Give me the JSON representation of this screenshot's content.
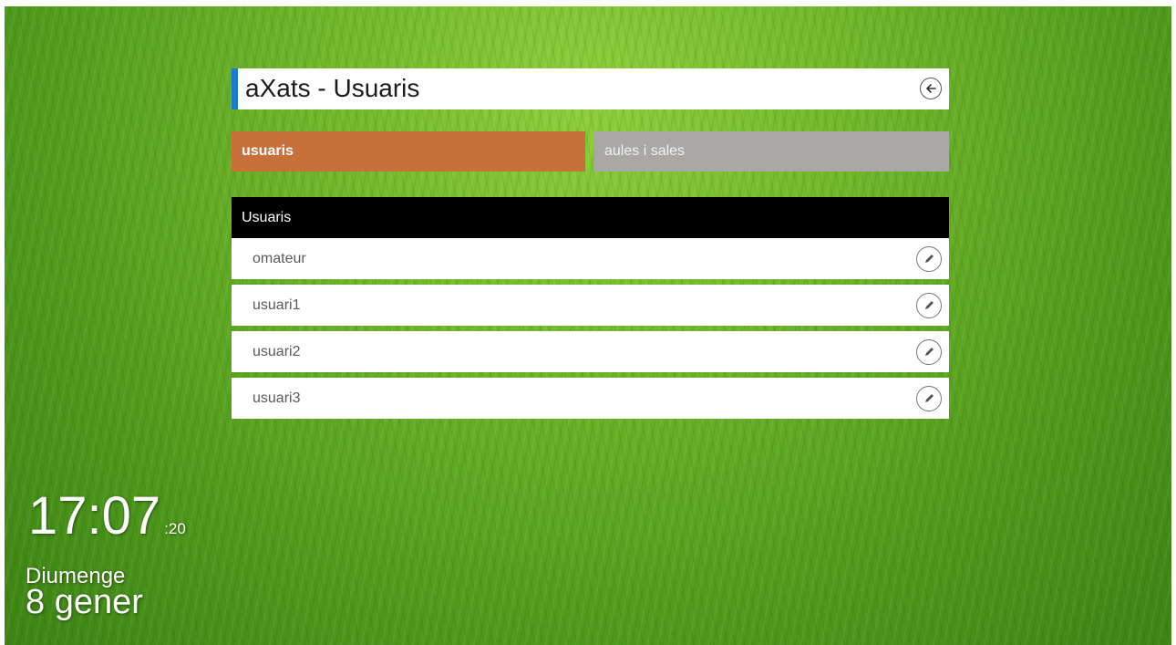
{
  "app": {
    "title": "aXats - Usuaris"
  },
  "tabs": [
    {
      "label": "usuaris",
      "active": true
    },
    {
      "label": "aules i sales",
      "active": false
    }
  ],
  "list": {
    "header": "Usuaris",
    "rows": [
      {
        "name": "omateur"
      },
      {
        "name": "usuari1"
      },
      {
        "name": "usuari2"
      },
      {
        "name": "usuari3"
      }
    ],
    "row_action_icon": "pencil-icon"
  },
  "clock": {
    "time": "17:07",
    "seconds": ":20",
    "day": "Diumenge",
    "date": "8 gener"
  },
  "colors": {
    "accent_bar": "#1a7bd0",
    "active_tab": "#c8703a",
    "inactive_tab": "#a9a8a6",
    "list_header": "#000000"
  }
}
